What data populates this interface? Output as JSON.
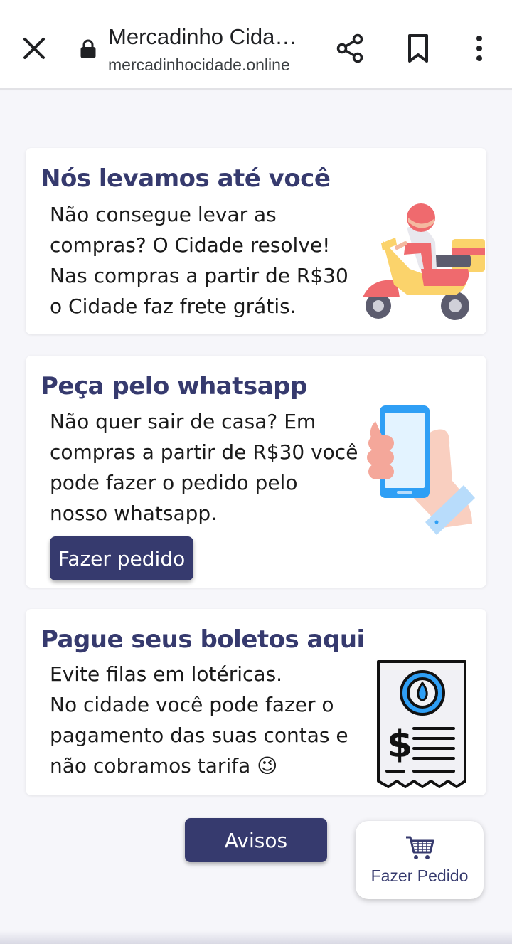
{
  "browser": {
    "title": "Mercadinho Cida…",
    "url": "mercadinhocidade.online",
    "icons": [
      "close-icon",
      "lock-icon",
      "share-icon",
      "bookmark-icon",
      "more-icon"
    ]
  },
  "cards": [
    {
      "title": "Nós levamos até você",
      "text": "Não consegue levar as\ncompras? O Cidade resolve!\nNas compras a partir de R$30\no Cidade faz frete grátis.",
      "illustration": "delivery-scooter-icon"
    },
    {
      "title": "Peça pelo whatsapp",
      "text": "Não quer sair de casa? Em\ncompras a partir de R$30 você\npode fazer o pedido pelo\nnosso whatsapp.",
      "button": "Fazer pedido",
      "illustration": "hand-phone-icon"
    },
    {
      "title": "Pague seus boletos aqui",
      "text": "Evite filas em lotéricas.\nNo cidade você pode fazer o\npagamento das suas contas e\nnão cobramos tarifa 😉",
      "illustration": "bill-receipt-icon"
    }
  ],
  "actions": {
    "avisos": "Avisos",
    "fazer_pedido": "Fazer Pedido"
  },
  "colors": {
    "brand": "#363a6e",
    "background": "#f6f6fa"
  }
}
